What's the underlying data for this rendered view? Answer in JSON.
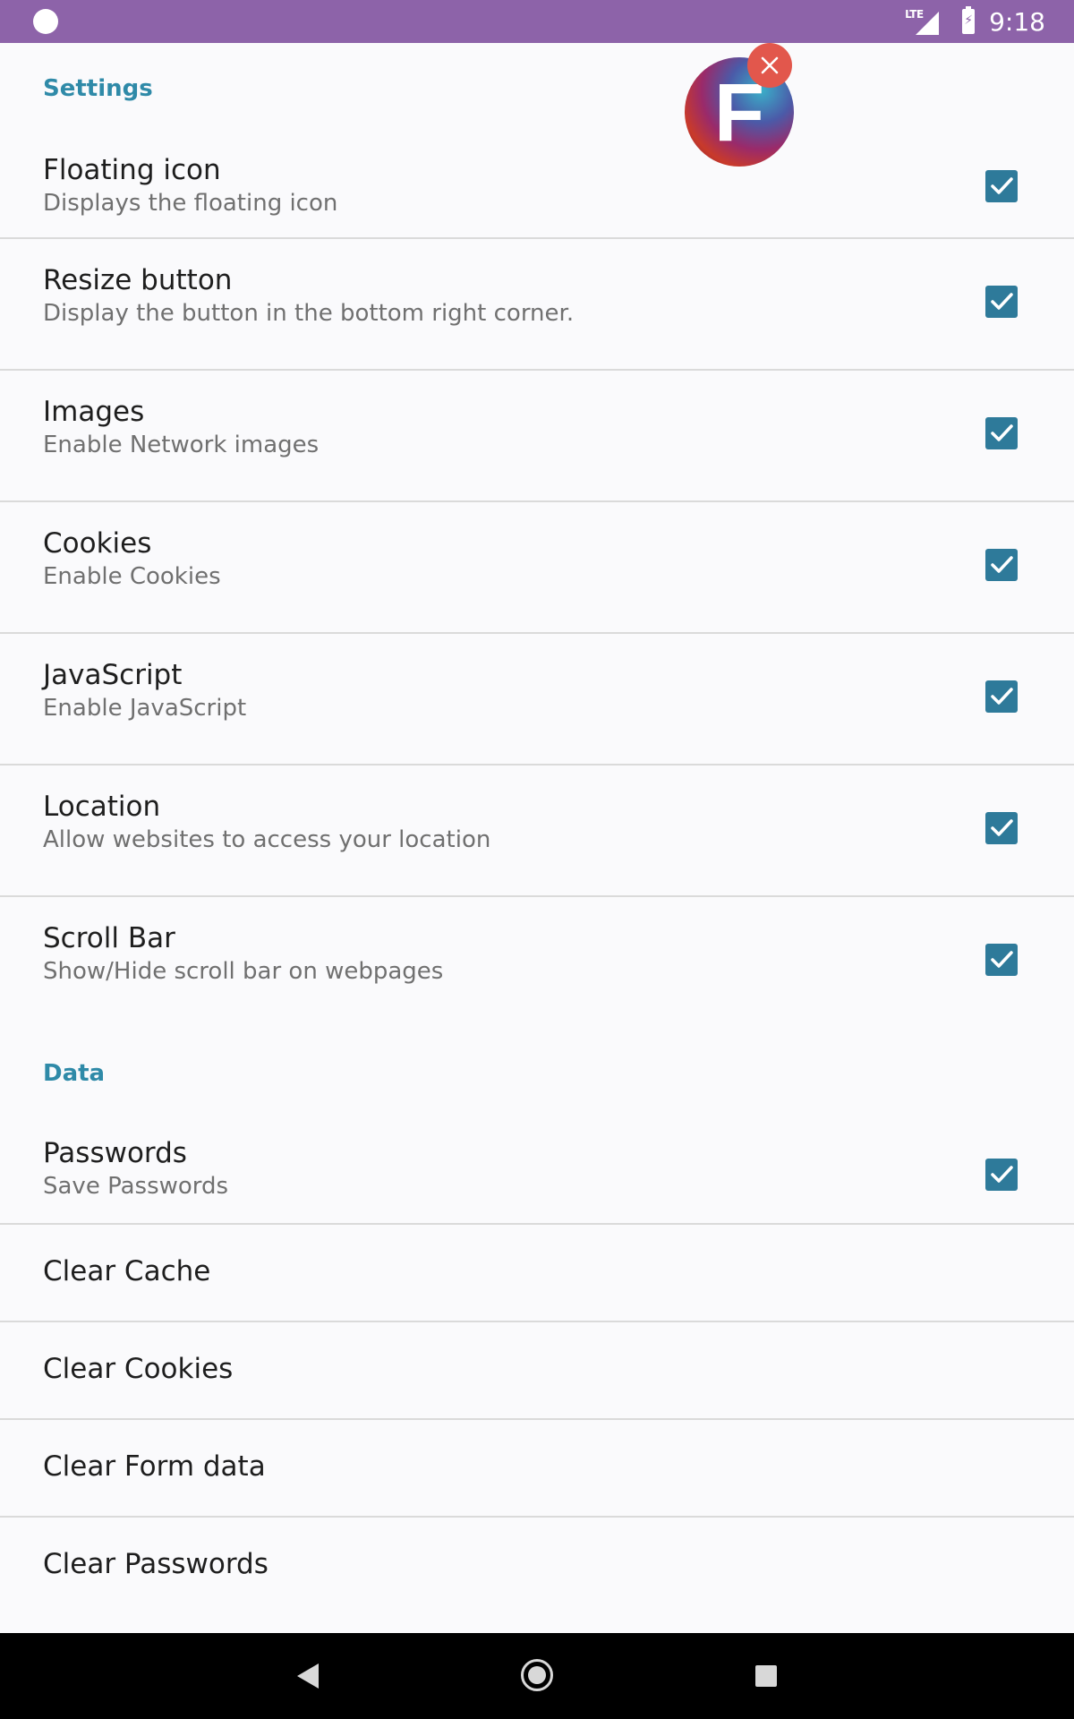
{
  "status_bar": {
    "network": "LTE",
    "time": "9:18",
    "background_color": "#8d63a9"
  },
  "sections": {
    "settings_header": "Settings",
    "data_header": "Data"
  },
  "floating_icon": {
    "letter": "F",
    "close_icon": "close-icon"
  },
  "prefs": [
    {
      "title": "Floating icon",
      "summary": "Displays the floating icon",
      "checked": true
    },
    {
      "title": "Resize button",
      "summary": "Display the button in the bottom right corner.",
      "checked": true
    },
    {
      "title": "Images",
      "summary": "Enable Network images",
      "checked": true
    },
    {
      "title": "Cookies",
      "summary": "Enable Cookies",
      "checked": true
    },
    {
      "title": "JavaScript",
      "summary": "Enable JavaScript",
      "checked": true
    },
    {
      "title": "Location",
      "summary": "Allow websites to access your location",
      "checked": true
    },
    {
      "title": "Scroll Bar",
      "summary": "Show/Hide scroll bar on webpages",
      "checked": true
    },
    {
      "title": "Passwords",
      "summary": "Save Passwords",
      "checked": true
    }
  ],
  "actions": [
    {
      "title": "Clear Cache"
    },
    {
      "title": "Clear Cookies"
    },
    {
      "title": "Clear Form data"
    },
    {
      "title": "Clear Passwords"
    }
  ],
  "colors": {
    "accent": "#2f8aa8",
    "checkbox": "#2e7a9a",
    "close_button": "#e2574c"
  },
  "nav_bar": {
    "back_icon": "back-icon",
    "home_icon": "home-icon",
    "recents_icon": "recents-icon"
  }
}
